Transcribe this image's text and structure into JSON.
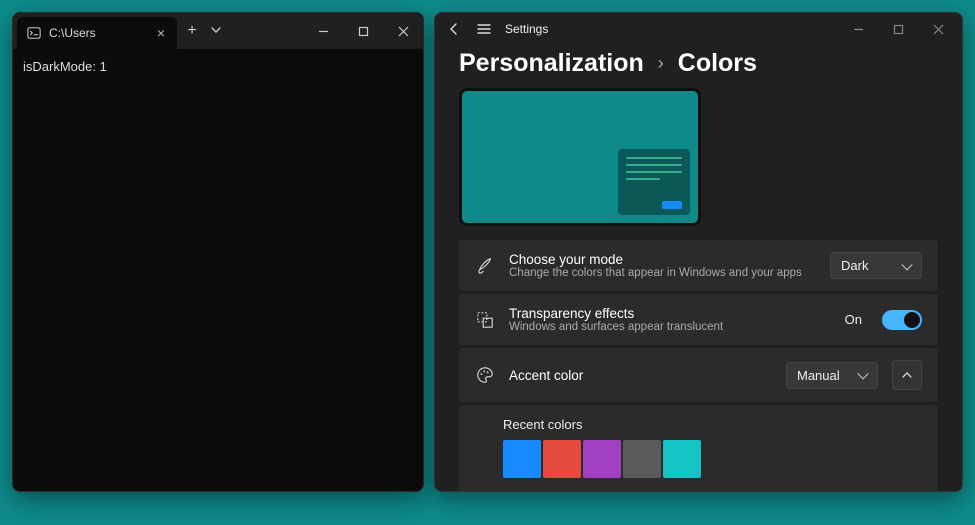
{
  "terminal": {
    "tab_title": "C:\\Users",
    "output": "isDarkMode: 1"
  },
  "settings": {
    "app_title": "Settings",
    "breadcrumb_parent": "Personalization",
    "breadcrumb_current": "Colors",
    "mode": {
      "title": "Choose your mode",
      "desc": "Change the colors that appear in Windows and your apps",
      "value": "Dark"
    },
    "transparency": {
      "title": "Transparency effects",
      "desc": "Windows and surfaces appear translucent",
      "state_label": "On"
    },
    "accent": {
      "title": "Accent color",
      "value": "Manual"
    },
    "recent": {
      "title": "Recent colors",
      "colors": [
        "#1989ff",
        "#e54b3c",
        "#a040c0",
        "#5a5a5a",
        "#14c4c4"
      ]
    }
  }
}
